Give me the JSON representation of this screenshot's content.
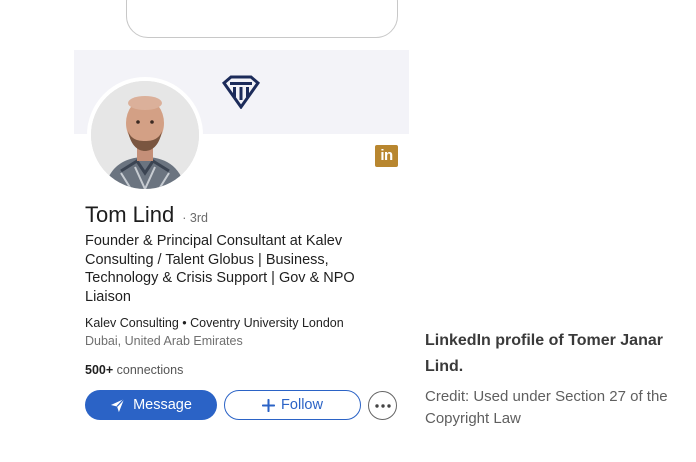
{
  "profile": {
    "name": "Tom Lind",
    "degree": "· 3rd",
    "headline": "Founder & Principal Consultant at Kalev Consulting / Talent Globus | Business, Technology & Crisis Support | Gov & NPO Liaison",
    "company_line": "Kalev Consulting • Coventry University London",
    "location": "Dubai, United Arab Emirates",
    "connections_count": "500+",
    "connections_label": " connections",
    "linkedin_badge": "in"
  },
  "actions": {
    "message_label": "Message",
    "follow_label": "Follow",
    "more_label": "···"
  },
  "caption": {
    "title": "LinkedIn profile of Tomer Janar Lind.",
    "credit": "Credit: Used under Section 27 of the Copyright Law"
  },
  "colors": {
    "primary": "#2b63c6",
    "badge": "#b8862f",
    "banner": "#f3f3f8",
    "logo": "#1c2b5a"
  }
}
